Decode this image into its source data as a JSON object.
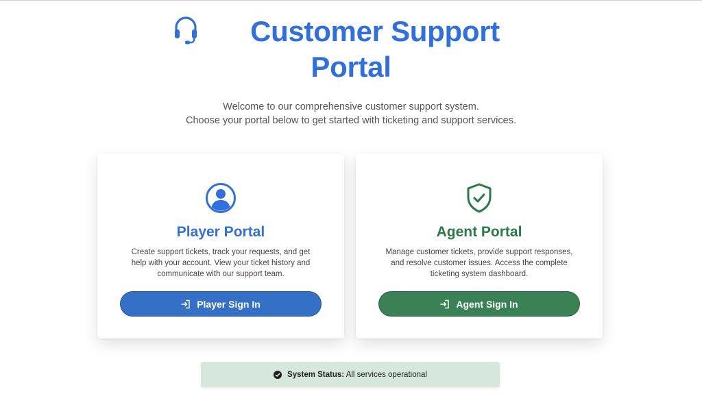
{
  "header": {
    "title_line1": "Customer Support",
    "title_line2": "Portal",
    "subtitle_line1": "Welcome to our comprehensive customer support system.",
    "subtitle_line2": "Choose your portal below to get started with ticketing and support services."
  },
  "player_card": {
    "title": "Player Portal",
    "description": "Create support tickets, track your requests, and get help with your account. View your ticket history and communicate with our support team.",
    "button_label": "Player Sign In",
    "icon": "user-circle-icon"
  },
  "agent_card": {
    "title": "Agent Portal",
    "description": "Manage customer tickets, provide support responses, and resolve customer issues. Access the complete ticketing system dashboard.",
    "button_label": "Agent Sign In",
    "icon": "shield-check-icon"
  },
  "status": {
    "label": "System Status:",
    "value": "All services operational"
  },
  "colors": {
    "brand_blue": "#2f6fdf",
    "player_button": "#3470c6",
    "agent_green": "#2a7a45",
    "agent_button": "#3a8153",
    "status_bg": "#d6e7dd"
  }
}
